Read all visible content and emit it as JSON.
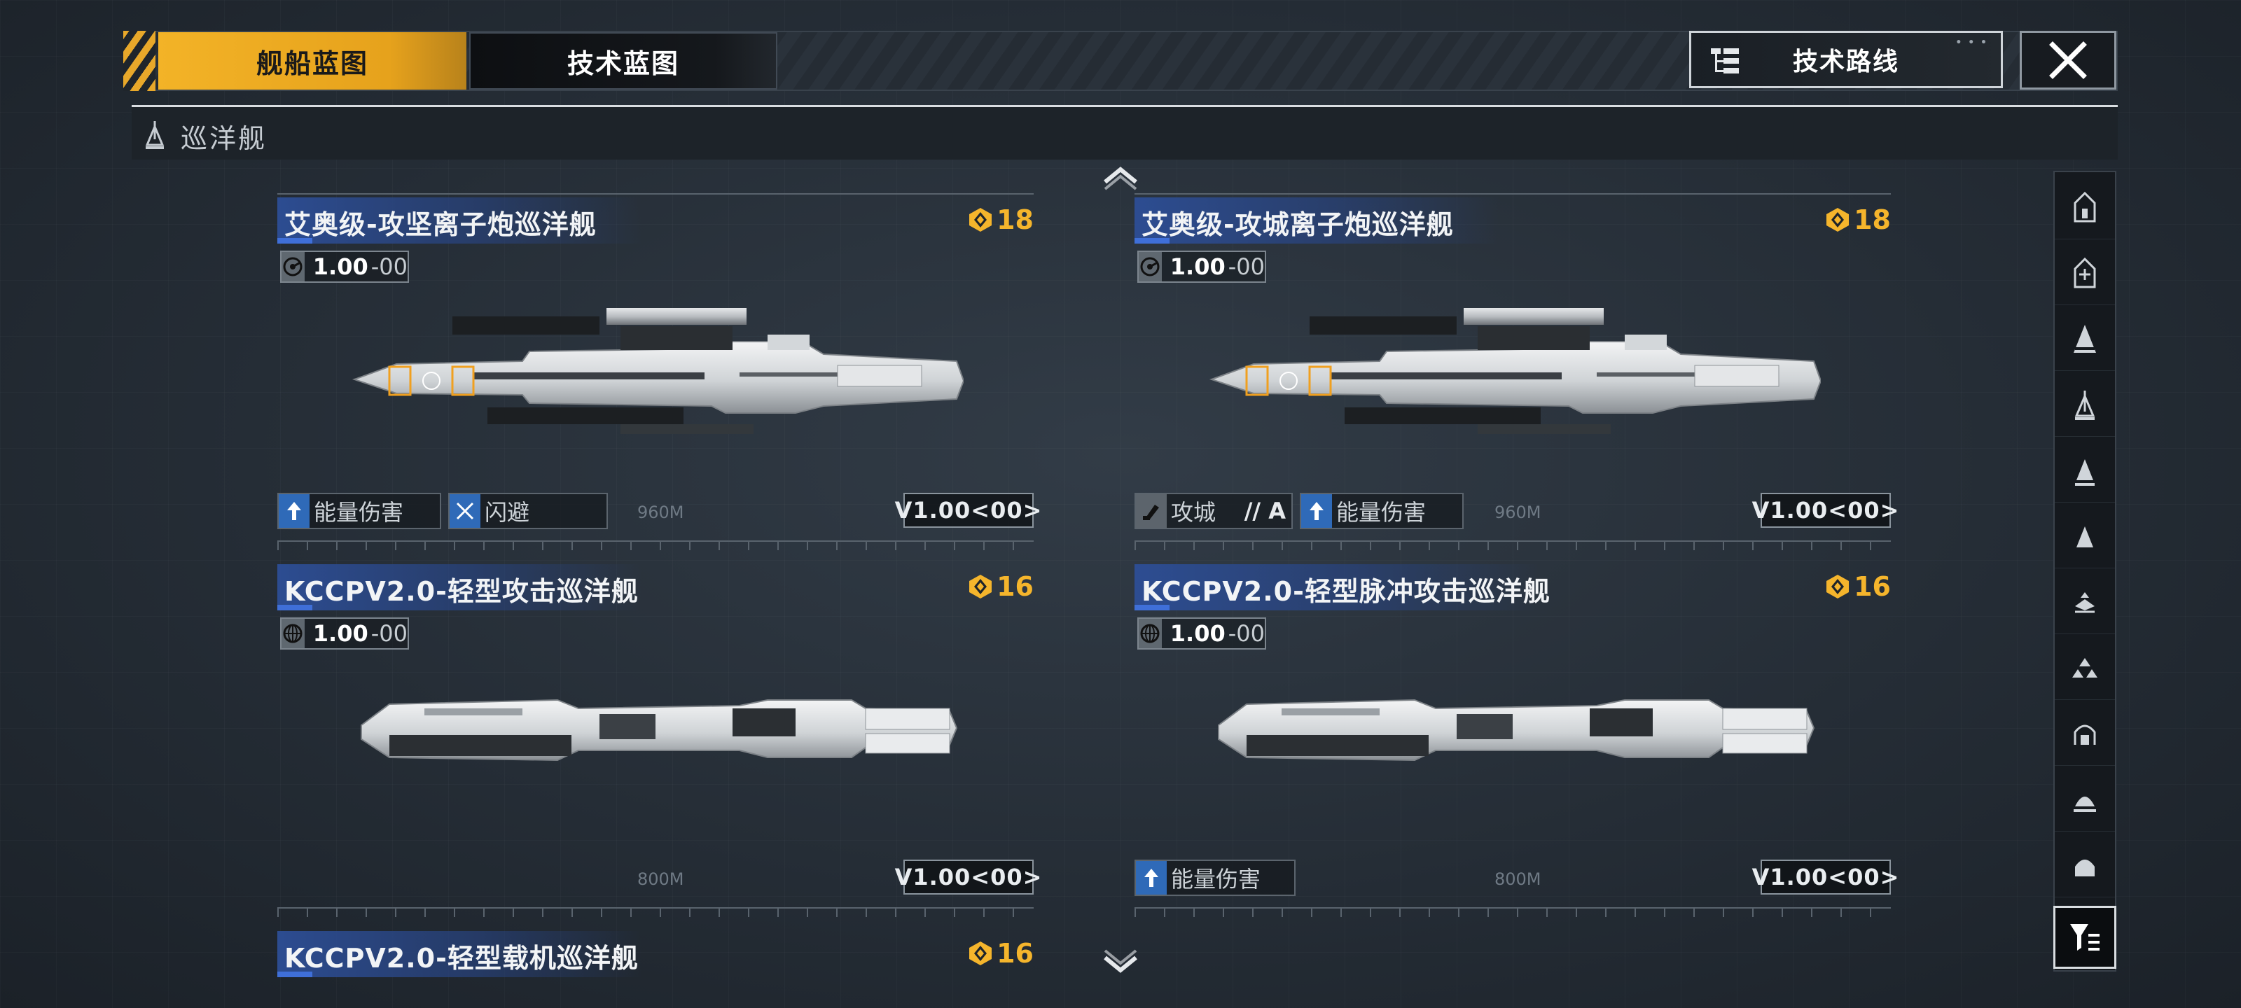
{
  "tabs": {
    "ship_blueprint": "舰船蓝图",
    "tech_blueprint": "技术蓝图"
  },
  "tech_route_label": "技术路线",
  "category": {
    "label": "巡洋舰",
    "icon": "cruiser-icon"
  },
  "accent_color": "#f3b327",
  "ships": [
    {
      "name": "艾奥级-攻坚离子炮巡洋舰",
      "cost": "18",
      "chip_value": "1.00",
      "chip_suffix": "-00",
      "chip_icon": "radar-icon",
      "tags": [
        {
          "label": "能量伤害",
          "icon": "arrow-up-icon"
        },
        {
          "label": "闪避",
          "icon": "dodge-icon"
        }
      ],
      "distance": "960M",
      "version": "V1.00<00>"
    },
    {
      "name": "艾奥级-攻城离子炮巡洋舰",
      "cost": "18",
      "chip_value": "1.00",
      "chip_suffix": "-00",
      "chip_icon": "radar-icon",
      "tags": [
        {
          "label": "攻城",
          "suffix": "// A",
          "icon": "siege-icon"
        },
        {
          "label": "能量伤害",
          "icon": "arrow-up-icon"
        }
      ],
      "distance": "960M",
      "version": "V1.00<00>"
    },
    {
      "name": "KCCPV2.0-轻型攻击巡洋舰",
      "cost": "16",
      "chip_value": "1.00",
      "chip_suffix": "-00",
      "chip_icon": "globe-icon",
      "tags": [],
      "distance": "800M",
      "version": "V1.00<00>"
    },
    {
      "name": "KCCPV2.0-轻型脉冲攻击巡洋舰",
      "cost": "16",
      "chip_value": "1.00",
      "chip_suffix": "-00",
      "chip_icon": "globe-icon",
      "tags": [
        {
          "label": "能量伤害",
          "icon": "arrow-up-icon"
        }
      ],
      "distance": "800M",
      "version": "V1.00<00>"
    },
    {
      "name": "KCCPV2.0-轻型载机巡洋舰",
      "cost": "16"
    }
  ],
  "filter_rail": [
    "carrier-class-icon",
    "battleship-class-icon",
    "cruiser-heavy-icon",
    "cruiser-icon",
    "destroyer-icon",
    "frigate-icon",
    "corvette-icon",
    "fighter-group-icon",
    "auxiliary-icon",
    "industrial-icon",
    "station-icon"
  ]
}
